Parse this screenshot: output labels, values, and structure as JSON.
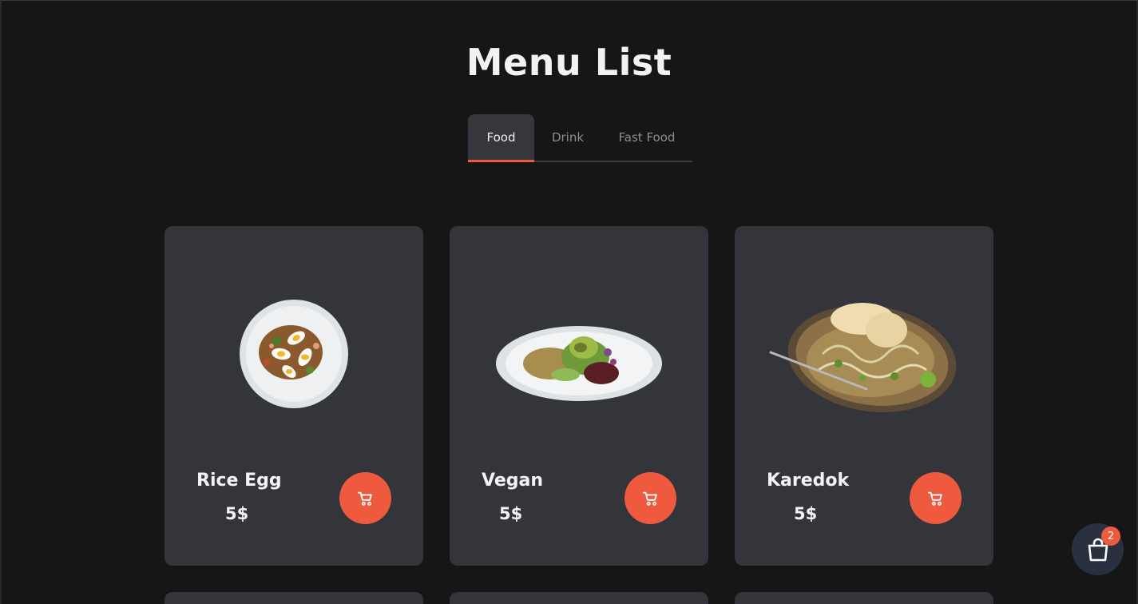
{
  "page": {
    "title": "Menu List"
  },
  "tabs": [
    {
      "label": "Food",
      "active": true
    },
    {
      "label": "Drink",
      "active": false
    },
    {
      "label": "Fast Food",
      "active": false
    }
  ],
  "menu": {
    "items": [
      {
        "name": "Rice Egg",
        "price": "5$",
        "image": "rice-egg-bowl"
      },
      {
        "name": "Vegan",
        "price": "5$",
        "image": "vegan-plate"
      },
      {
        "name": "Karedok",
        "price": "5$",
        "image": "karedok-plate"
      }
    ]
  },
  "cart": {
    "count": "2",
    "icon": "shopping-bag-icon"
  },
  "colors": {
    "background": "#161616",
    "card": "#33353a",
    "accent": "#ef5a3f",
    "bag_button": "#293140"
  }
}
